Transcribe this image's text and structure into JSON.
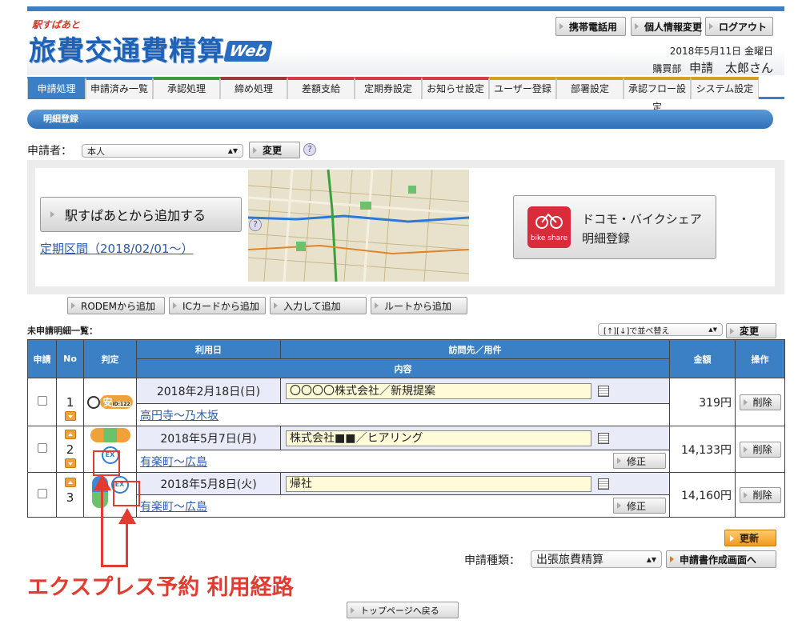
{
  "header": {
    "logo_small": "駅すぱあと",
    "logo_main": "旅費交通費精算",
    "logo_web": "Web",
    "buttons": [
      "携帯電話用",
      "個人情報変更",
      "ログアウト"
    ],
    "date": "2018年5月11日 金曜日",
    "dept": "購買部",
    "user": "申請　太郎さん"
  },
  "tabs": [
    {
      "label": "申請処理",
      "color": "#3b7fc4",
      "active": true
    },
    {
      "label": "申請済み一覧",
      "color": "#3b7fc4"
    },
    {
      "label": "承認処理",
      "color": "#3a9a3a"
    },
    {
      "label": "締め処理",
      "color": "#9a3a3a"
    },
    {
      "label": "差額支給",
      "color": "#d63a4a"
    },
    {
      "label": "定期券設定",
      "color": "#d63a4a"
    },
    {
      "label": "お知らせ設定",
      "color": "#d63a4a"
    },
    {
      "label": "ユーザー登録",
      "color": "#d4a020"
    },
    {
      "label": "部署設定",
      "color": "#d4a020"
    },
    {
      "label": "承認フロー設定",
      "color": "#d4a020"
    },
    {
      "label": "システム設定",
      "color": "#d4a020"
    }
  ],
  "section_title": "明細登録",
  "applicant": {
    "label": "申請者：",
    "value": "本人",
    "change": "変更"
  },
  "banner": {
    "add_button": "駅すぱあとから追加する",
    "teiki_link": "定期区間（2018/02/01〜）",
    "bike_line1": "ドコモ・バイクシェア",
    "bike_line2": "明細登録",
    "bike_icon_text": "bike share"
  },
  "sub_buttons": [
    "RODEMから追加",
    "ICカードから追加",
    "入力して追加",
    "ルートから追加"
  ],
  "list_label": "未申請明細一覧：",
  "sort": {
    "value": "[↑][↓]で並べ替え",
    "button": "変更"
  },
  "table": {
    "headers": {
      "apply": "申請",
      "no": "No",
      "judge": "判定",
      "date": "利用日",
      "visit": "訪問先／用件",
      "content": "内容",
      "amount": "金額",
      "op": "操作"
    },
    "rows": [
      {
        "no": "1",
        "date": "2018年2月18日(日)",
        "purpose": "〇〇〇〇株式会社／新規提案",
        "route": "高円寺〜乃木坂",
        "amount": "319円",
        "fix": ""
      },
      {
        "no": "2",
        "date": "2018年5月7日(月)",
        "purpose": "株式会社■■／ヒアリング",
        "route": "有楽町〜広島",
        "amount": "14,133円",
        "fix": "修正"
      },
      {
        "no": "3",
        "date": "2018年5月8日(火)",
        "purpose": "帰社",
        "route": "有楽町〜広島",
        "amount": "14,160円",
        "fix": "修正"
      }
    ],
    "delete_label": "削除",
    "ex_label": "EX",
    "badge_text": "安",
    "badge_sub": "ID:122"
  },
  "update_button": "更新",
  "apply_type": {
    "label": "申請種類：",
    "value": "出張旅費精算",
    "button": "申請書作成画面へ"
  },
  "annotation": "エクスプレス予約 利用経路",
  "back_button": "トップページへ戻る"
}
